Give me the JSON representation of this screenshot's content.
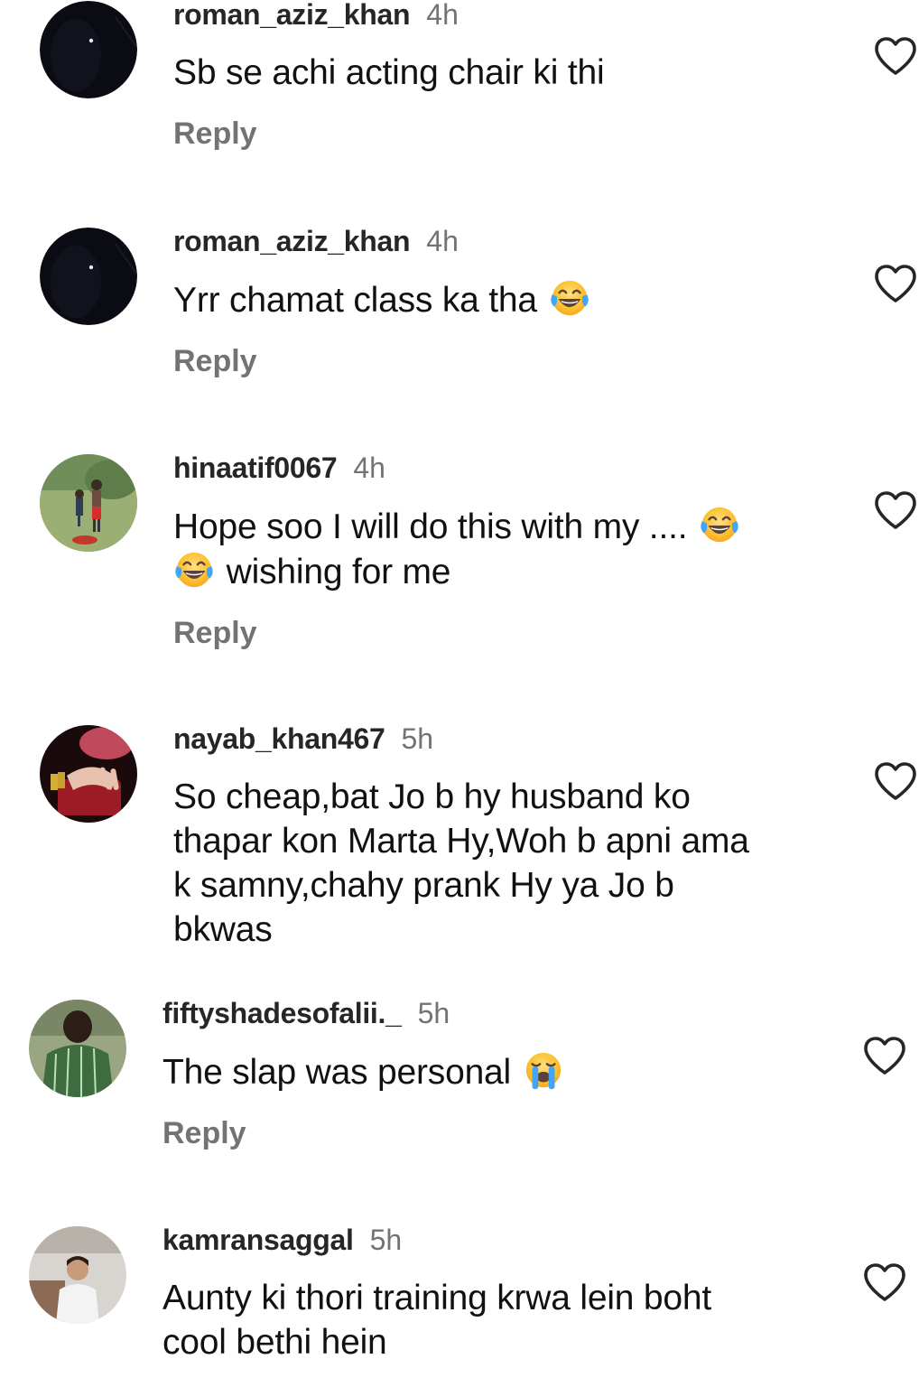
{
  "comments": [
    {
      "username": "roman_aziz_khan",
      "time": "4h",
      "text": "Sb se achi acting chair ki thi",
      "reply_label": "Reply",
      "avatar": "night-sky-avatar",
      "emojis": []
    },
    {
      "username": "roman_aziz_khan",
      "time": "4h",
      "text": "Yrr chamat class ka tha",
      "reply_label": "Reply",
      "avatar": "night-sky-avatar",
      "emojis": [
        "face-with-tears-of-joy"
      ]
    },
    {
      "username": "hinaatif0067",
      "time": "4h",
      "text_line1": "Hope soo I will do this with my ....",
      "text_line2": "wishing for me",
      "reply_label": "Reply",
      "avatar": "children-outdoors-avatar",
      "emojis": [
        "face-with-tears-of-joy",
        "face-with-tears-of-joy"
      ]
    },
    {
      "username": "nayab_khan467",
      "time": "5h",
      "text_lines": [
        "So cheap,bat Jo b hy husband ko",
        "thapar kon Marta Hy,Woh b apni ama",
        "k samny,chahy prank Hy ya Jo b",
        "bkwas"
      ],
      "avatar": "hand-with-bangles-avatar",
      "emojis": []
    },
    {
      "username": "fiftyshadesofalii._",
      "time": "5h",
      "text": "The slap was personal",
      "reply_label": "Reply",
      "avatar": "green-jersey-avatar",
      "emojis": [
        "loudly-crying-face"
      ]
    },
    {
      "username": "kamransaggal",
      "time": "5h",
      "text_lines": [
        "Aunty ki thori training krwa lein boht",
        "cool bethi hein"
      ],
      "avatar": "man-white-shirt-avatar",
      "emojis": []
    }
  ],
  "icons": {
    "like": "heart-outline-icon"
  },
  "colors": {
    "username": "#262626",
    "secondary": "#737373",
    "text": "#111111",
    "emoji_yellow": "#FBC02D",
    "tear_blue": "#42A5F5"
  }
}
